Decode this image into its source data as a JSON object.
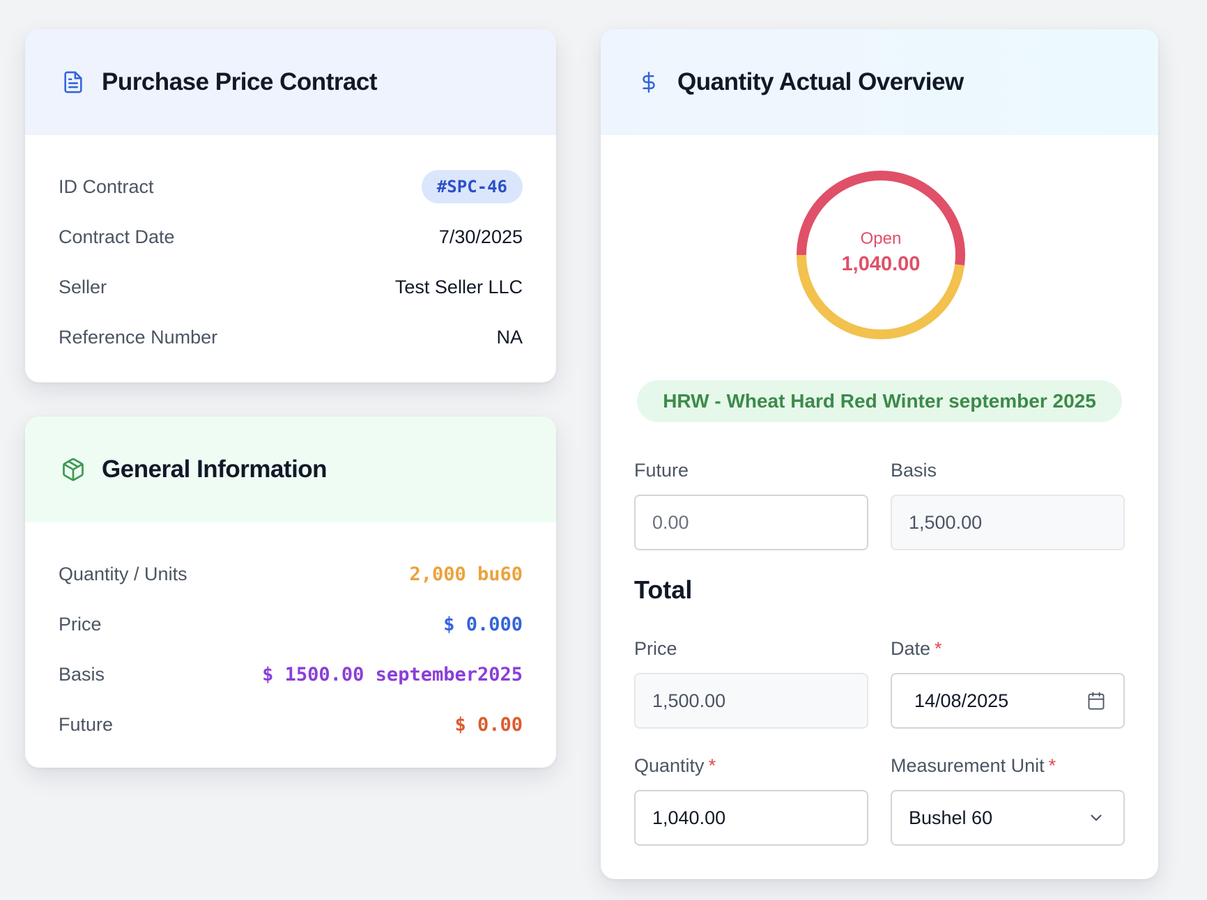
{
  "contract": {
    "title": "Purchase Price Contract",
    "icon": "document-icon",
    "rows": [
      {
        "label": "ID Contract",
        "value": "#SPC-46"
      },
      {
        "label": "Contract Date",
        "value": "7/30/2025"
      },
      {
        "label": "Seller",
        "value": "Test Seller LLC"
      },
      {
        "label": "Reference Number",
        "value": "NA"
      }
    ]
  },
  "general": {
    "title": "General Information",
    "icon": "package-icon",
    "rows": [
      {
        "label": "Quantity / Units",
        "value": "2,000 bu60",
        "color": "#eba23c"
      },
      {
        "label": "Price",
        "value": "$ 0.000",
        "color": "#3464dc"
      },
      {
        "label": "Basis",
        "value": "$ 1500.00 september2025",
        "color": "#8b3ed8"
      },
      {
        "label": "Future",
        "value": "$ 0.00",
        "color": "#dc5a2c"
      }
    ]
  },
  "overview": {
    "title": "Quantity Actual Overview",
    "icon": "dollar-icon",
    "donut": {
      "label": "Open",
      "value": "1,040.00",
      "segments": [
        {
          "name": "open",
          "fraction": 0.52,
          "color": "#e05068"
        },
        {
          "name": "remaining",
          "fraction": 0.48,
          "color": "#f2c14e"
        }
      ]
    },
    "commodity": "HRW - Wheat Hard Red Winter september 2025",
    "future": {
      "label": "Future",
      "placeholder": "0.00"
    },
    "basis": {
      "label": "Basis",
      "value": "1,500.00"
    },
    "total_title": "Total",
    "price": {
      "label": "Price",
      "value": "1,500.00"
    },
    "date": {
      "label": "Date",
      "required_mark": "*",
      "value": "14/08/2025",
      "icon": "calendar-icon"
    },
    "quantity": {
      "label": "Quantity",
      "required_mark": "*",
      "value": "1,040.00"
    },
    "unit": {
      "label": "Measurement Unit",
      "required_mark": "*",
      "value": "Bushel 60",
      "icon": "chevron-down-icon"
    }
  }
}
